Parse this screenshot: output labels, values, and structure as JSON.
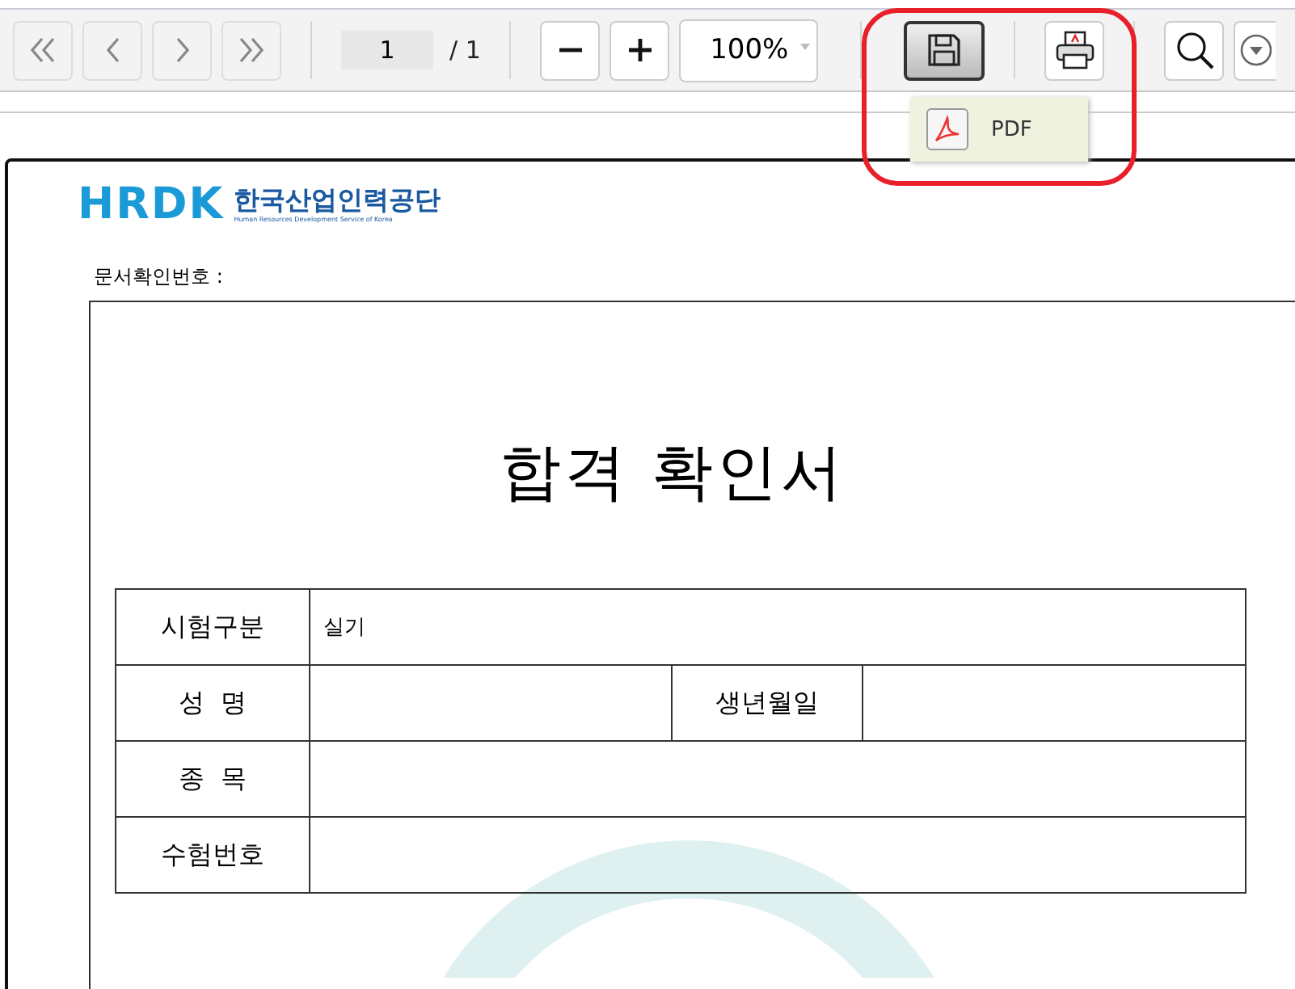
{
  "toolbar": {
    "nav_buttons": [
      {
        "kind": "first",
        "disabled": true
      },
      {
        "kind": "prev",
        "disabled": true
      },
      {
        "kind": "next",
        "disabled": true
      },
      {
        "kind": "last",
        "disabled": true
      }
    ],
    "page_input": {
      "value": "1"
    },
    "page_total": "/ 1",
    "zoom": {
      "value": "100%"
    },
    "save_button": {
      "selected": true
    },
    "save_menu": {
      "expanded": true,
      "items": [
        {
          "label": "PDF"
        }
      ]
    },
    "highlight": {
      "color": "#e8202a"
    }
  },
  "document": {
    "logo": {
      "wordmark": "HRDK",
      "name": "한국산업인력공단",
      "subtitle": "Human Resources Development Service of Korea"
    },
    "doc_number_label": "문서확인번호 :",
    "title": "합격 확인서",
    "rows": [
      [
        {
          "kind": "header",
          "text": "시험구분"
        },
        {
          "kind": "value",
          "text": "실기",
          "colspan": 3
        }
      ],
      [
        {
          "kind": "header",
          "text": "성  명"
        },
        {
          "kind": "value",
          "text": ""
        },
        {
          "kind": "header",
          "text": "생년월일"
        },
        {
          "kind": "value",
          "text": ""
        }
      ],
      [
        {
          "kind": "header",
          "text": "종  목"
        },
        {
          "kind": "value",
          "text": "",
          "colspan": 3
        }
      ],
      [
        {
          "kind": "header",
          "text": "수험번호"
        },
        {
          "kind": "value",
          "text": "",
          "colspan": 3
        }
      ]
    ]
  }
}
